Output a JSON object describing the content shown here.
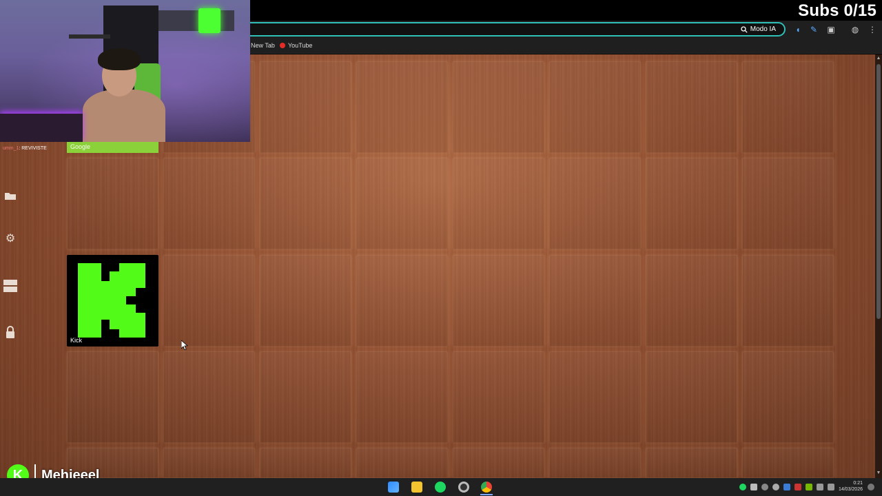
{
  "overlay": {
    "subs_counter": "Subs 0/15",
    "streamer_name": "Mehieeel",
    "chat": {
      "user": "umm_1",
      "message": ": REVIVISTE"
    }
  },
  "browser": {
    "ai_mode_label": "Modo IA",
    "bookmarks": [
      {
        "label": "New Tab",
        "icon": "new-tab-icon"
      },
      {
        "label": "YouTube",
        "icon": "youtube-icon"
      }
    ]
  },
  "speed_dial": {
    "tiles": [
      {
        "label": "Google",
        "color": "#8bd13a"
      },
      {
        "label": "Kick",
        "color": "#53fc18"
      }
    ]
  },
  "sidebar": {
    "icons": [
      "folder-icon",
      "gear-icon",
      "layers-icon",
      "lock-icon"
    ]
  },
  "taskbar": {
    "apps": [
      "windows-start-icon",
      "file-explorer-icon",
      "spotify-icon",
      "obs-icon",
      "chrome-icon"
    ],
    "clock_time": "0:21",
    "clock_date": "14/03/2026"
  },
  "colors": {
    "kick_green": "#53fc18",
    "omnibox_border": "#2fc0b8",
    "wood": "#8f4e30"
  }
}
